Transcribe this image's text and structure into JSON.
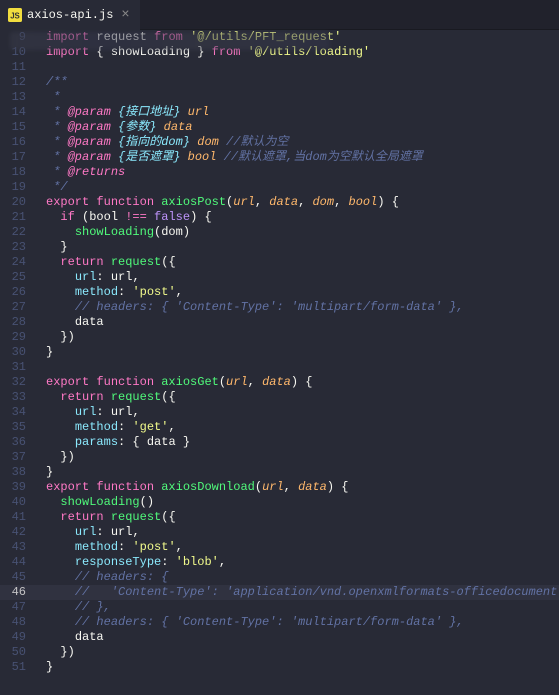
{
  "tab": {
    "label": "axios-api.js",
    "close_glyph": "×"
  },
  "gutter": {
    "start": 9,
    "end": 51,
    "active": 46
  },
  "code": {
    "l9": {
      "kw1": "import",
      "id1": "request",
      "kw2": "from",
      "str": "'@/utils/PFT_request'"
    },
    "l10": {
      "kw1": "import",
      "id1": "showLoading",
      "kw2": "from",
      "str": "'@/utils/loading'"
    },
    "l12": {
      "c": "/**"
    },
    "l13": {
      "c": " * "
    },
    "l14": {
      "tag": "@param",
      "p": "{接口地址}",
      "name": "url"
    },
    "l15": {
      "tag": "@param",
      "p": "{参数}",
      "name": "data"
    },
    "l16": {
      "tag": "@param",
      "p": "{指向的dom}",
      "name": "dom",
      "tail": " //默认为空"
    },
    "l17": {
      "tag": "@param",
      "p": "{是否遮罩}",
      "name": "bool",
      "tail": " //默认遮罩,当dom为空默认全局遮罩"
    },
    "l18": {
      "tag": "@returns"
    },
    "l19": {
      "c": " */"
    },
    "l20": {
      "kw1": "export",
      "kw2": "function",
      "fn": "axiosPost",
      "args": [
        "url",
        "data",
        "dom",
        "bool"
      ]
    },
    "l21": {
      "kw": "if",
      "id": "bool",
      "op": "!==",
      "val": "false"
    },
    "l22": {
      "fn": "showLoading",
      "arg": "dom"
    },
    "l24": {
      "kw": "return",
      "fn": "request"
    },
    "l25": {
      "k": "url",
      "v": "url"
    },
    "l26": {
      "k": "method",
      "v": "'post'"
    },
    "l27": {
      "c": "// headers: { 'Content-Type': 'multipart/form-data' },"
    },
    "l28": {
      "id": "data"
    },
    "l32": {
      "kw1": "export",
      "kw2": "function",
      "fn": "axiosGet",
      "args": [
        "url",
        "data"
      ]
    },
    "l33": {
      "kw": "return",
      "fn": "request"
    },
    "l34": {
      "k": "url",
      "v": "url"
    },
    "l35": {
      "k": "method",
      "v": "'get'"
    },
    "l36": {
      "k": "params",
      "id": "data"
    },
    "l39": {
      "kw1": "export",
      "kw2": "function",
      "fn": "axiosDownload",
      "args": [
        "url",
        "data"
      ]
    },
    "l40": {
      "fn": "showLoading"
    },
    "l41": {
      "kw": "return",
      "fn": "request"
    },
    "l42": {
      "k": "url",
      "v": "url"
    },
    "l43": {
      "k": "method",
      "v": "'post'"
    },
    "l44": {
      "k": "responseType",
      "v": "'blob'"
    },
    "l45": {
      "c": "// headers: {"
    },
    "l46": {
      "c": "//   'Content-Type': 'application/vnd.openxmlformats-officedocument.spreadsheetml.sheet'"
    },
    "l47": {
      "c": "// },"
    },
    "l48": {
      "c": "// headers: { 'Content-Type': 'multipart/form-data' },"
    },
    "l49": {
      "id": "data"
    }
  }
}
